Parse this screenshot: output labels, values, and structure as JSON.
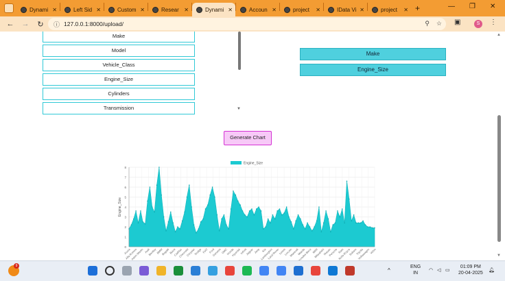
{
  "browser": {
    "tabs": [
      {
        "label": "Dynami",
        "active": false
      },
      {
        "label": "Left Sid",
        "active": false
      },
      {
        "label": "Custom",
        "active": false
      },
      {
        "label": "Resear",
        "active": false
      },
      {
        "label": "Dynami",
        "active": true
      },
      {
        "label": "Accoun",
        "active": false
      },
      {
        "label": "project",
        "active": false
      },
      {
        "label": "IData Vi",
        "active": false
      },
      {
        "label": "project",
        "active": false
      }
    ],
    "url": "127.0.0.1:8000/upload/",
    "profile_initial": "S"
  },
  "columns": [
    "Make",
    "Model",
    "Vehicle_Class",
    "Engine_Size",
    "Cylinders",
    "Transmission"
  ],
  "selected_columns": [
    "Make",
    "Engine_Size"
  ],
  "generate_label": "Generate Chart",
  "chart_data": {
    "type": "line",
    "fill": true,
    "series": [
      {
        "name": "Engine_Size",
        "color": "#1ccad1",
        "values": [
          1.8,
          2.2,
          2.8,
          3.6,
          2.4,
          3.6,
          2.5,
          2.3,
          4.6,
          6.0,
          4.0,
          3.5,
          6.2,
          8.0,
          5.2,
          3.0,
          1.6,
          2.5,
          3.5,
          2.4,
          1.5,
          2.0,
          1.8,
          2.6,
          3.5,
          5.0,
          6.2,
          4.0,
          2.2,
          1.4,
          1.8,
          2.5,
          2.8,
          3.8,
          4.2,
          5.2,
          6.0,
          5.0,
          3.2,
          1.6,
          2.8,
          3.2,
          2.2,
          1.8,
          3.8,
          5.6,
          5.2,
          4.6,
          4.2,
          3.6,
          3.2,
          3.0,
          3.6,
          3.8,
          3.2,
          3.8,
          4.0,
          3.6,
          1.8,
          2.0,
          2.8,
          2.4,
          3.2,
          2.8,
          3.6,
          3.8,
          3.2,
          3.4,
          4.0,
          3.0,
          2.5,
          1.8,
          2.6,
          3.2,
          2.8,
          2.2,
          1.8,
          2.4,
          2.0,
          1.6,
          2.0,
          2.6,
          4.0,
          1.5,
          2.4,
          3.6,
          2.8,
          1.5,
          2.2,
          2.4,
          3.6,
          3.0,
          3.8,
          2.4,
          6.6,
          4.8,
          2.6,
          3.2,
          2.4,
          2.4,
          2.4,
          2.6,
          2.2,
          2.0,
          2.0,
          1.9,
          1.9
        ]
      }
    ],
    "ylim": [
      0,
      8
    ],
    "yticks": [
      0,
      1,
      2,
      3,
      4,
      5,
      6,
      7,
      8
    ],
    "ylabel": "Engine_Size",
    "xticklabels": [
      "Acura",
      "Alfa Romeo",
      "Aston Martin",
      "Audi",
      "Bentley",
      "BMW",
      "Bugatti",
      "Buick",
      "Cadillac",
      "Chevrolet",
      "Chrysler",
      "Dodge",
      "FIAT",
      "Ford",
      "Genesis",
      "GMC",
      "Honda",
      "Hyundai",
      "Infiniti",
      "Jaguar",
      "Jeep",
      "Kia",
      "Lamborghini",
      "Land Rover",
      "Lexus",
      "Lincoln",
      "Maserati",
      "Mazda",
      "Mercedes-Benz",
      "MINI",
      "Mitsubishi",
      "Nissan",
      "Porsche",
      "Ram",
      "Rolls-Royce",
      "Subaru",
      "Toyota",
      "Volkswagen",
      "Volvo"
    ],
    "grid": true,
    "legend": "top"
  },
  "taskbar": {
    "lang": "ENG",
    "region": "IN",
    "time": "01:09 PM",
    "date": "20-04-2025"
  }
}
